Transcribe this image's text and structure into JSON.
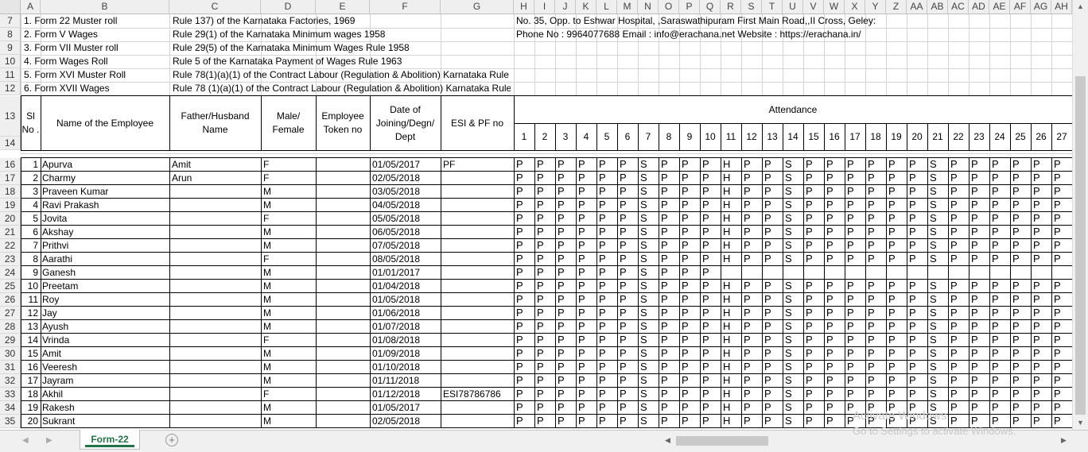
{
  "columns": [
    "A",
    "B",
    "C",
    "D",
    "E",
    "F",
    "G",
    "H",
    "I",
    "J",
    "K",
    "L",
    "M",
    "N",
    "O",
    "P",
    "Q",
    "R",
    "S",
    "T",
    "U",
    "V",
    "W",
    "X",
    "Y",
    "Z",
    "AA",
    "AB",
    "AC",
    "AD",
    "AE",
    "AF",
    "AG",
    "AH"
  ],
  "info_rows": [
    {
      "row": "7",
      "a": "1. Form  22     Muster roll",
      "b": "Rule 137) of the Karnataka Factories, 1969",
      "h": "No. 35, Opp. to Eshwar Hospital, ,Saraswathipuram First Main Road,,II Cross, Geley:"
    },
    {
      "row": "8",
      "a": "2. Form V        Wages",
      "b": " Rule 29(1) of the Karnataka Minimum wages 1958",
      "h": "Phone No : 9964077688 Email : info@erachana.net Website : https://erachana.in/"
    },
    {
      "row": "9",
      "a": "3. Form VII     Muster roll",
      "b": "Rule 29(5) of the Karnataka Minimum Wages Rule 1958",
      "h": ""
    },
    {
      "row": "10",
      "a": "4. Form         Wages Roll",
      "b": "Rule 5 of the Karnataka Payment of Wages Rule 1963",
      "h": ""
    },
    {
      "row": "11",
      "a": "5. Form XVI    Muster Roll",
      "b": "  Rule 78(1)(a)(1) of the Contract Labour (Regulation & Abolition) Karnataka Rule 1974",
      "h": ""
    },
    {
      "row": "12",
      "a": "6. Form XVII    Wages",
      "b": "Rule 78 (1)(a)(1) of the Contract Labour  (Regulation & Abolition) Karnataka Rule 1974",
      "h": ""
    }
  ],
  "header": {
    "row13": "13",
    "row14": "14",
    "sl_no": "Sl No .",
    "name": "Name of the Employee",
    "father": "Father/Husband Name",
    "gender": "Male/ Female",
    "token": "Employee Token no",
    "doj": "Date of Joining/Degn/ Dept",
    "esi": "ESI & PF no",
    "attendance": "Attendance",
    "days": [
      "1",
      "2",
      "3",
      "4",
      "5",
      "6",
      "7",
      "8",
      "9",
      "10",
      "11",
      "12",
      "13",
      "14",
      "15",
      "16",
      "17",
      "18",
      "19",
      "20",
      "21",
      "22",
      "23",
      "24",
      "25",
      "26",
      "27"
    ]
  },
  "employees": [
    {
      "row": "16",
      "sl": "1",
      "name": "Apurva",
      "father": "Amit",
      "gender": "F",
      "doj": "01/05/2017",
      "esi": "PF",
      "att": "PPPPPPSPPPHPPSPPPPPPSPPPPPP"
    },
    {
      "row": "17",
      "sl": "2",
      "name": "Charmy",
      "father": "Arun",
      "gender": "F",
      "doj": "02/05/2018",
      "esi": "",
      "att": "PPPPPPSPPPHPPSPPPPPPSPPPPPP"
    },
    {
      "row": "18",
      "sl": "3",
      "name": "Praveen Kumar",
      "father": "",
      "gender": "M",
      "doj": "03/05/2018",
      "esi": "",
      "att": "PPPPPPSPPPHPPSPPPPPPSPPPPPP"
    },
    {
      "row": "19",
      "sl": "4",
      "name": "Ravi Prakash",
      "father": "",
      "gender": "M",
      "doj": "04/05/2018",
      "esi": "",
      "att": "PPPPPPSPPPHPPSPPPPPPSPPPPPP"
    },
    {
      "row": "20",
      "sl": "5",
      "name": "Jovita",
      "father": "",
      "gender": "F",
      "doj": "05/05/2018",
      "esi": "",
      "att": "PPPPPPSPPPHPPSPPPPPPSPPPPPP"
    },
    {
      "row": "21",
      "sl": "6",
      "name": "Akshay",
      "father": "",
      "gender": "M",
      "doj": "06/05/2018",
      "esi": "",
      "att": "PPPPPPSPPPHPPSPPPPPPSPPPPPP"
    },
    {
      "row": "22",
      "sl": "7",
      "name": "Prithvi",
      "father": "",
      "gender": "M",
      "doj": "07/05/2018",
      "esi": "",
      "att": "PPPPPPSPPPHPPSPPPPPPSPPPPPP"
    },
    {
      "row": "23",
      "sl": "8",
      "name": "Aarathi",
      "father": "",
      "gender": "F",
      "doj": "08/05/2018",
      "esi": "",
      "att": "PPPPPPSPPPHPPSPPPPPPSPPPPPP"
    },
    {
      "row": "24",
      "sl": "9",
      "name": "Ganesh",
      "father": "",
      "gender": "M",
      "doj": "01/01/2017",
      "esi": "",
      "att": "PPPPPPSPPP"
    },
    {
      "row": "25",
      "sl": "10",
      "name": "Preetam",
      "father": "",
      "gender": "M",
      "doj": "01/04/2018",
      "esi": "",
      "att": "PPPPPPSPPPHPPSPPPPPPSPPPPPP"
    },
    {
      "row": "26",
      "sl": "11",
      "name": "Roy",
      "father": "",
      "gender": "M",
      "doj": "01/05/2018",
      "esi": "",
      "att": "PPPPPPSPPPHPPSPPPPPPSPPPPPP"
    },
    {
      "row": "27",
      "sl": "12",
      "name": "Jay",
      "father": "",
      "gender": "M",
      "doj": "01/06/2018",
      "esi": "",
      "att": "PPPPPPSPPPHPPSPPPPPPSPPPPPP"
    },
    {
      "row": "28",
      "sl": "13",
      "name": "Ayush",
      "father": "",
      "gender": "M",
      "doj": "01/07/2018",
      "esi": "",
      "att": "PPPPPPSPPPHPPSPPPPPPSPPPPPP"
    },
    {
      "row": "29",
      "sl": "14",
      "name": "Vrinda",
      "father": "",
      "gender": "F",
      "doj": "01/08/2018",
      "esi": "",
      "att": "PPPPPPSPPPHPPSPPPPPPSPPPPPP"
    },
    {
      "row": "30",
      "sl": "15",
      "name": "Amit",
      "father": "",
      "gender": "M",
      "doj": "01/09/2018",
      "esi": "",
      "att": "PPPPPPSPPPHPPSPPPPPPSPPPPPP"
    },
    {
      "row": "31",
      "sl": "16",
      "name": "Veeresh",
      "father": "",
      "gender": "M",
      "doj": "01/10/2018",
      "esi": "",
      "att": "PPPPPPSPPPHPPSPPPPPPSPPPPPP"
    },
    {
      "row": "32",
      "sl": "17",
      "name": "Jayram",
      "father": "",
      "gender": "M",
      "doj": "01/11/2018",
      "esi": "",
      "att": "PPPPPPSPPPHPPSPPPPPPSPPPPPP"
    },
    {
      "row": "33",
      "sl": "18",
      "name": "Akhil",
      "father": "",
      "gender": "F",
      "doj": "01/12/2018",
      "esi": "ESI78786786",
      "att": "PPPPPPSPPPHPPSPPPPPPSPPPPPP"
    },
    {
      "row": "34",
      "sl": "19",
      "name": "Rakesh",
      "father": "",
      "gender": "M",
      "doj": "01/05/2017",
      "esi": "",
      "att": "PPPPPPSPPPHPPSPPPPPPSPPPPPP"
    },
    {
      "row": "35",
      "sl": "20",
      "name": "Sukrant",
      "father": "",
      "gender": "M",
      "doj": "02/05/2018",
      "esi": "",
      "att": "PPPPPPSPPPHPPSPPPPPPSPPPPPP"
    }
  ],
  "sheet_tab": "Form-22",
  "add_sheet_icon": "plus-circle-icon",
  "watermark": {
    "line1": "Activate Windows",
    "line2": "Go to Settings to activate Windows."
  },
  "colors": {
    "accent": "#217346",
    "header_bg": "#efefef",
    "grid": "#d4d4d4"
  }
}
